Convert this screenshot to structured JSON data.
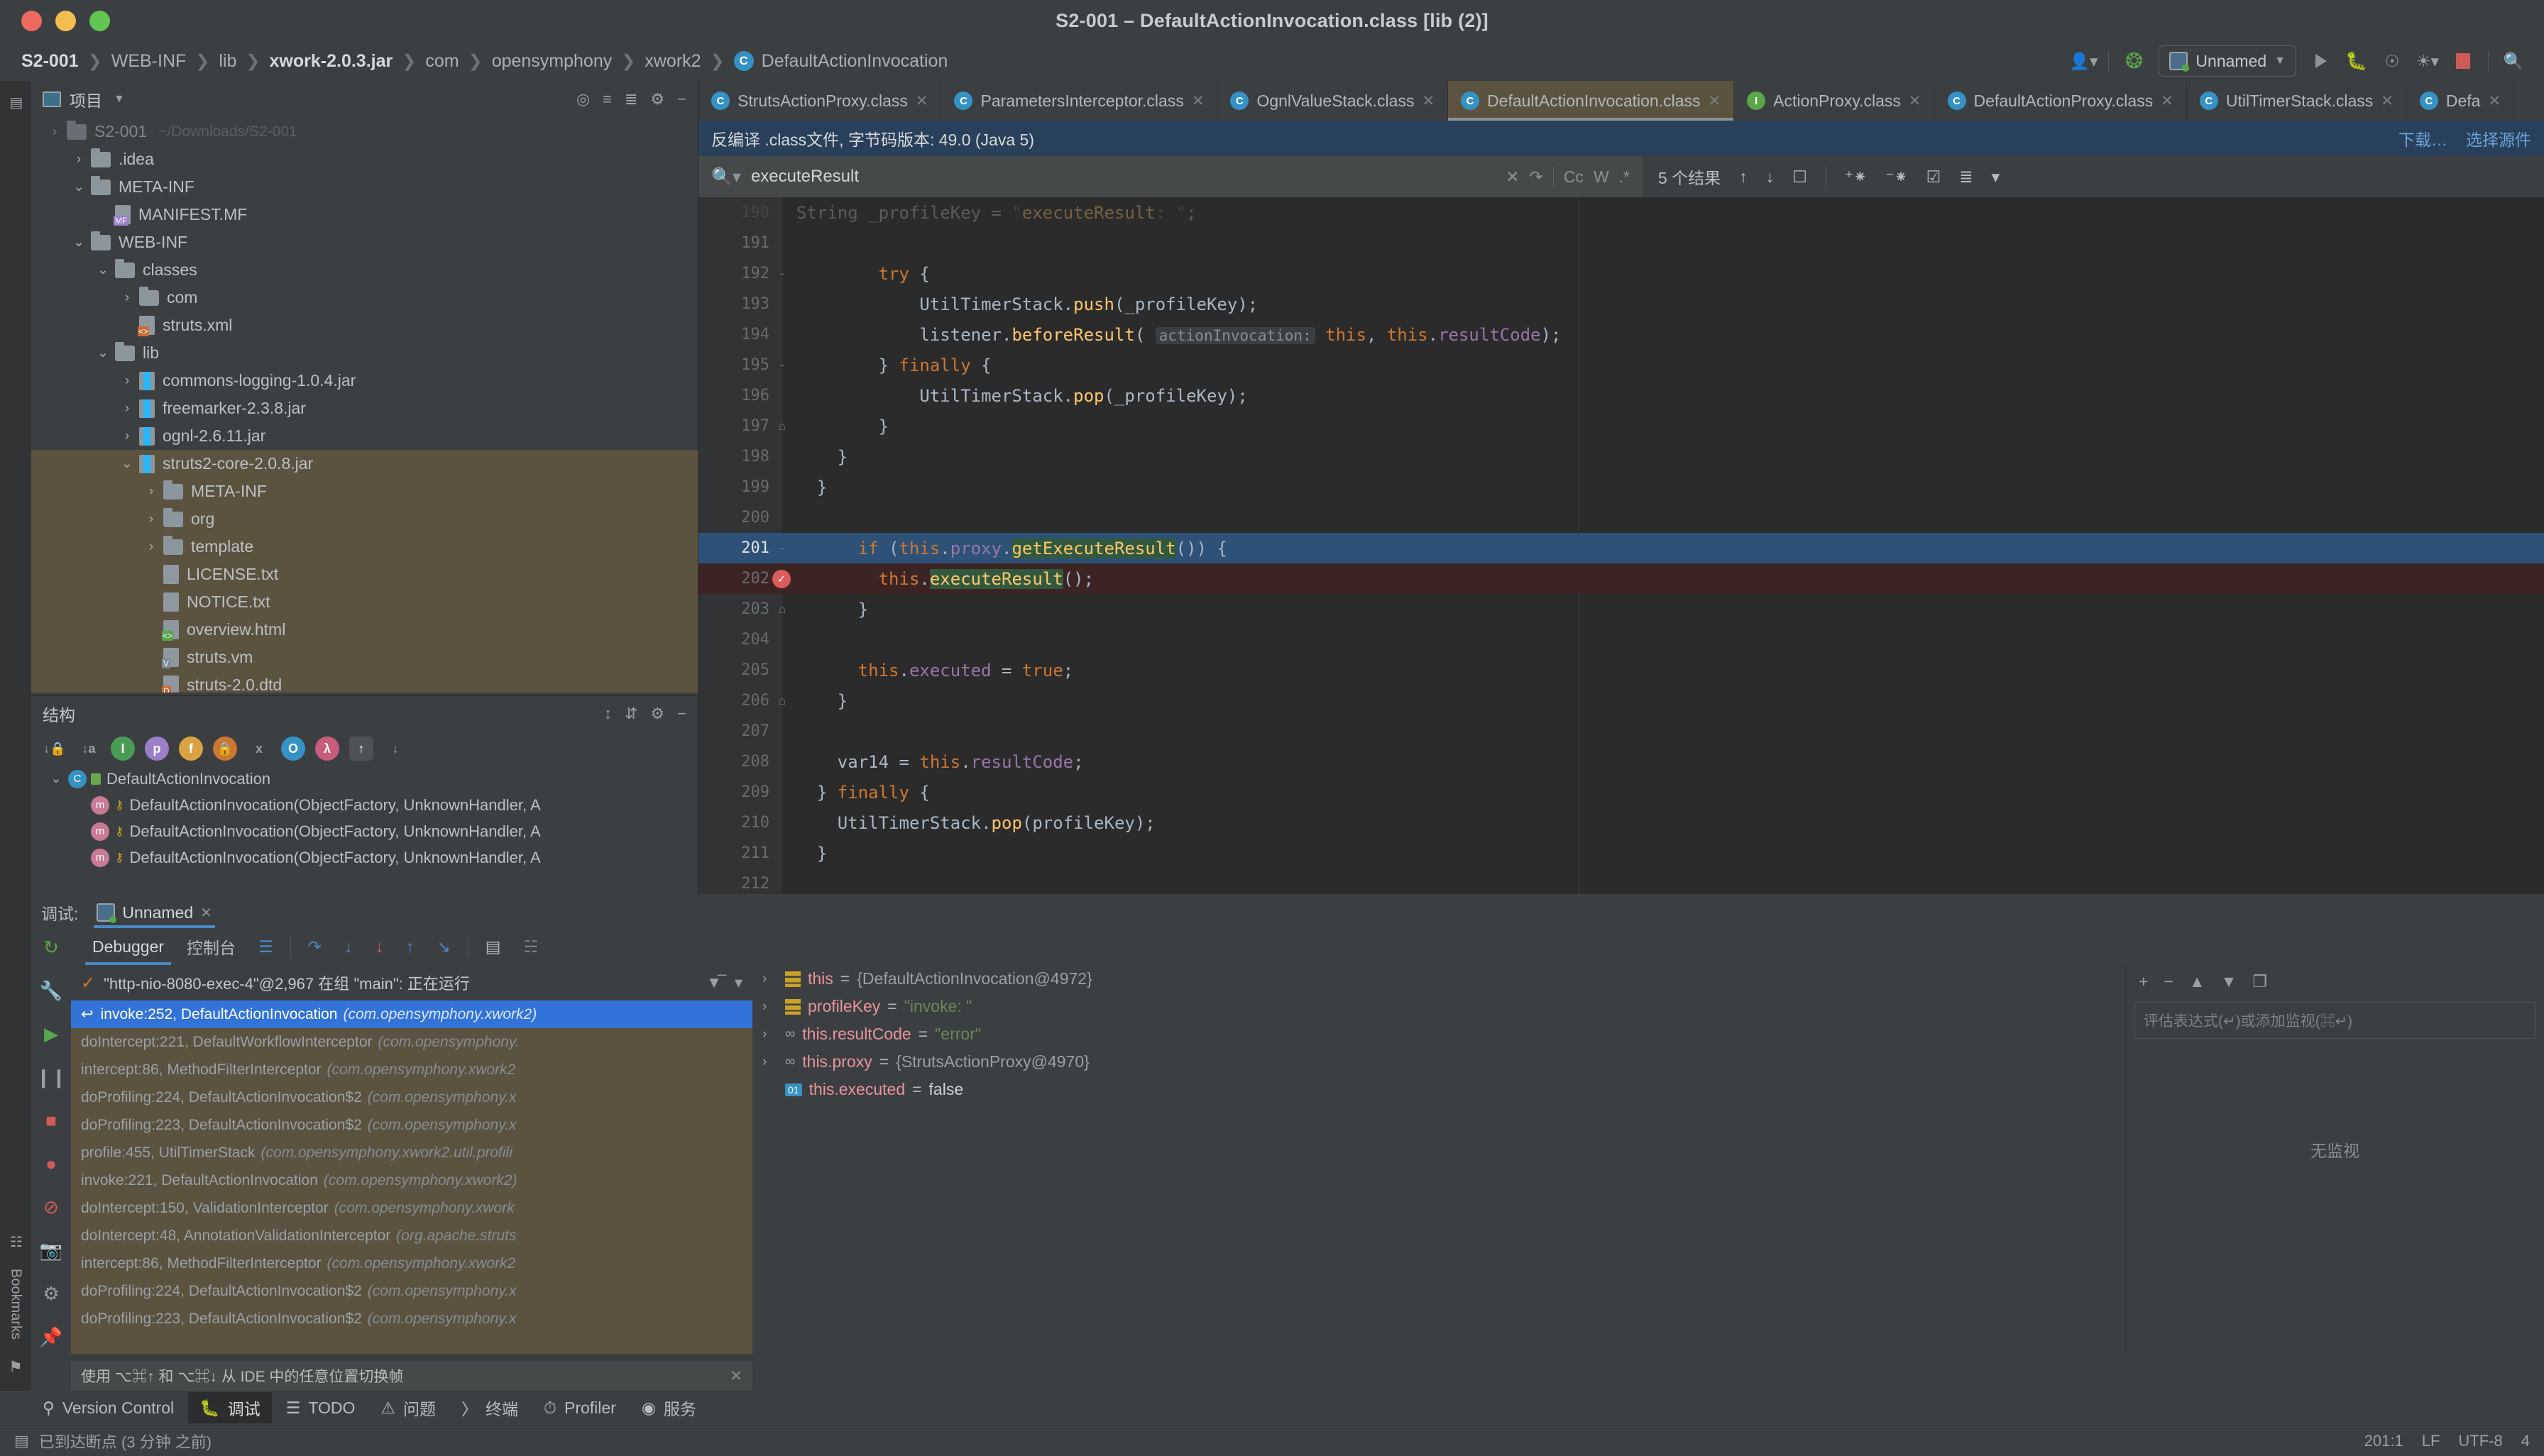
{
  "window": {
    "title": "S2-001 – DefaultActionInvocation.class [lib (2)]"
  },
  "breadcrumb": {
    "items": [
      {
        "label": "S2-001",
        "bold": true
      },
      {
        "label": "WEB-INF",
        "bold": false
      },
      {
        "label": "lib",
        "bold": false
      },
      {
        "label": "xwork-2.0.3.jar",
        "bold": true
      },
      {
        "label": "com",
        "bold": false
      },
      {
        "label": "opensymphony",
        "bold": false
      },
      {
        "label": "xwork2",
        "bold": false
      },
      {
        "label": "DefaultActionInvocation",
        "bold": false,
        "icon": "class-icon"
      }
    ],
    "separator": "❯"
  },
  "toolbar": {
    "account_icon": "account-icon",
    "build_icon": "hammer-icon",
    "run_config_label": "Unnamed",
    "run_icon": "run-icon",
    "debug_icon": "debug-icon",
    "coverage_icon": "coverage-icon",
    "profile_icon": "profile-icon",
    "stop_icon": "stop-icon",
    "search_icon": "search-icon"
  },
  "project_panel": {
    "title": "项目",
    "root": {
      "name": "S2-001",
      "path": "~/Downloads/S2-001"
    },
    "tree": [
      {
        "indent": 0,
        "arrow": "›",
        "kind": "root",
        "label": "S2-001",
        "path": "~/Downloads/S2-001",
        "partial": true
      },
      {
        "indent": 1,
        "arrow": "›",
        "kind": "folder",
        "label": ".idea"
      },
      {
        "indent": 1,
        "arrow": "⌄",
        "kind": "folder",
        "label": "META-INF"
      },
      {
        "indent": 2,
        "arrow": "",
        "kind": "file-mf",
        "label": "MANIFEST.MF"
      },
      {
        "indent": 1,
        "arrow": "⌄",
        "kind": "folder",
        "label": "WEB-INF"
      },
      {
        "indent": 2,
        "arrow": "⌄",
        "kind": "folder",
        "label": "classes"
      },
      {
        "indent": 3,
        "arrow": "›",
        "kind": "folder",
        "label": "com"
      },
      {
        "indent": 3,
        "arrow": "",
        "kind": "file-xml",
        "label": "struts.xml"
      },
      {
        "indent": 2,
        "arrow": "⌄",
        "kind": "folder",
        "label": "lib"
      },
      {
        "indent": 3,
        "arrow": "›",
        "kind": "jar",
        "label": "commons-logging-1.0.4.jar"
      },
      {
        "indent": 3,
        "arrow": "›",
        "kind": "jar",
        "label": "freemarker-2.3.8.jar"
      },
      {
        "indent": 3,
        "arrow": "›",
        "kind": "jar",
        "label": "ognl-2.6.11.jar"
      },
      {
        "indent": 3,
        "arrow": "⌄",
        "kind": "jar",
        "label": "struts2-core-2.0.8.jar",
        "selected": true
      },
      {
        "indent": 4,
        "arrow": "›",
        "kind": "folder",
        "label": "META-INF",
        "selected": true
      },
      {
        "indent": 4,
        "arrow": "›",
        "kind": "folder",
        "label": "org",
        "selected": true
      },
      {
        "indent": 4,
        "arrow": "›",
        "kind": "folder",
        "label": "template",
        "selected": true
      },
      {
        "indent": 4,
        "arrow": "",
        "kind": "file-txt",
        "label": "LICENSE.txt",
        "selected": true
      },
      {
        "indent": 4,
        "arrow": "",
        "kind": "file-txt",
        "label": "NOTICE.txt",
        "selected": true
      },
      {
        "indent": 4,
        "arrow": "",
        "kind": "file-html",
        "label": "overview.html",
        "selected": true
      },
      {
        "indent": 4,
        "arrow": "",
        "kind": "file-vm",
        "label": "struts.vm",
        "selected": true
      },
      {
        "indent": 4,
        "arrow": "",
        "kind": "file-dtd",
        "label": "struts-2.0.dtd",
        "selected": true
      }
    ]
  },
  "structure_panel": {
    "title": "结构",
    "toolbar_icons": [
      "sort-by-visibility-icon",
      "sort-alphabetically-icon",
      "show-inherited-icon",
      "show-properties-icon",
      "show-fields-icon",
      "show-non-public-icon",
      "group-icon",
      "show-anonymous-icon",
      "show-lambdas-icon",
      "expand-all-icon",
      "collapse-all-icon"
    ],
    "head_icons": [
      "expand-all-icon",
      "collapse-all-icon",
      "settings-icon",
      "hide-icon"
    ],
    "items": [
      {
        "indent": 0,
        "arrow": "⌄",
        "kind": "class",
        "label": "DefaultActionInvocation"
      },
      {
        "indent": 1,
        "arrow": "",
        "kind": "method",
        "label": "DefaultActionInvocation(ObjectFactory, UnknownHandler, A"
      },
      {
        "indent": 1,
        "arrow": "",
        "kind": "method",
        "label": "DefaultActionInvocation(ObjectFactory, UnknownHandler, A"
      },
      {
        "indent": 1,
        "arrow": "",
        "kind": "method",
        "label": "DefaultActionInvocation(ObjectFactory, UnknownHandler, A"
      }
    ]
  },
  "editor": {
    "tabs": [
      {
        "label": "StrutsActionProxy.class",
        "icon": "class-icon",
        "active": false
      },
      {
        "label": "ParametersInterceptor.class",
        "icon": "class-icon",
        "active": false
      },
      {
        "label": "OgnlValueStack.class",
        "icon": "class-icon",
        "active": false
      },
      {
        "label": "DefaultActionInvocation.class",
        "icon": "class-icon",
        "active": true
      },
      {
        "label": "ActionProxy.class",
        "icon": "interface-icon",
        "active": false
      },
      {
        "label": "DefaultActionProxy.class",
        "icon": "class-icon",
        "active": false
      },
      {
        "label": "UtilTimerStack.class",
        "icon": "class-icon",
        "active": false
      },
      {
        "label": "Defa",
        "icon": "class-icon",
        "active": false
      }
    ],
    "notification": {
      "text": "反编译 .class文件, 字节码版本: 49.0 (Java 5)",
      "action_download": "下载…",
      "action_choose": "选择源件"
    },
    "find": {
      "query": "executeResult",
      "placeholder": "",
      "result_count": "5 个结果",
      "opt_case": "Cc",
      "opt_words": "W",
      "opt_regex": ".*",
      "close_icon": "close-icon",
      "history_icon": "history-icon",
      "prev_icon": "arrow-up-icon",
      "next_icon": "arrow-down-icon",
      "select_all_icon": "select-all-icon",
      "filter_icon": "filter-icon"
    },
    "code_lines": [
      {
        "num": 190,
        "fold": "",
        "text": "String _profileKey = \"executeResult: \";",
        "clipped": true
      },
      {
        "num": 191,
        "fold": "",
        "text": ""
      },
      {
        "num": 192,
        "fold": "-",
        "text": "        try {"
      },
      {
        "num": 193,
        "fold": "",
        "text": "            UtilTimerStack.push(_profileKey);"
      },
      {
        "num": 194,
        "fold": "",
        "text": "            listener.beforeResult( actionInvocation: this, this.resultCode);"
      },
      {
        "num": 195,
        "fold": "-",
        "text": "        } finally {"
      },
      {
        "num": 196,
        "fold": "",
        "text": "            UtilTimerStack.pop(_profileKey);"
      },
      {
        "num": 197,
        "fold": "⌂",
        "text": "        }"
      },
      {
        "num": 198,
        "fold": "",
        "text": "    }"
      },
      {
        "num": 199,
        "fold": "",
        "text": "  }"
      },
      {
        "num": 200,
        "fold": "",
        "text": ""
      },
      {
        "num": 201,
        "fold": "-",
        "text": "      if (this.proxy.getExecuteResult()) {",
        "highlight": "blue"
      },
      {
        "num": 202,
        "fold": "",
        "text": "        this.executeResult();",
        "highlight": "red",
        "breakpoint": true
      },
      {
        "num": 203,
        "fold": "⌂",
        "text": "      }"
      },
      {
        "num": 204,
        "fold": "",
        "text": ""
      },
      {
        "num": 205,
        "fold": "",
        "text": "      this.executed = true;"
      },
      {
        "num": 206,
        "fold": "⌂",
        "text": "    }"
      },
      {
        "num": 207,
        "fold": "",
        "text": ""
      },
      {
        "num": 208,
        "fold": "",
        "text": "    var14 = this.resultCode;"
      },
      {
        "num": 209,
        "fold": "",
        "text": "  } finally {"
      },
      {
        "num": 210,
        "fold": "",
        "text": "    UtilTimerStack.pop(profileKey);"
      },
      {
        "num": 211,
        "fold": "",
        "text": "  }"
      },
      {
        "num": 212,
        "fold": "",
        "text": ""
      }
    ]
  },
  "debug": {
    "label": "调试:",
    "session_tab": "Unnamed",
    "tabs": [
      {
        "label": "Debugger",
        "active": true
      },
      {
        "label": "控制台",
        "active": false
      }
    ],
    "toolbar_icons": [
      "frames-icon",
      "step-over-icon",
      "step-into-icon",
      "force-step-into-icon",
      "step-out-icon",
      "run-to-cursor-icon",
      "evaluate-icon",
      "mute-breakpoints-icon"
    ],
    "rail_icons": [
      "rerun-icon",
      "settings-icon",
      "resume-icon",
      "pause-icon",
      "stop-icon",
      "breakpoints-icon",
      "mute-breakpoints-icon",
      "camera-icon",
      "settings2-icon",
      "pin-icon"
    ],
    "thread": {
      "status_icon": "check-icon",
      "label": "\"http-nio-8080-exec-4\"@2,967 在组 \"main\": 正在运行",
      "filter_icon": "filter-icon",
      "dropdown_icon": "chevron-down-icon"
    },
    "frames": [
      {
        "text": "invoke:252, DefaultActionInvocation",
        "pkg": "(com.opensymphony.xwork2)",
        "selected": true,
        "icon": "return-arrow-icon"
      },
      {
        "text": "doIntercept:221, DefaultWorkflowInterceptor",
        "pkg": "(com.opensymphony.",
        "selected": false
      },
      {
        "text": "intercept:86, MethodFilterInterceptor",
        "pkg": "(com.opensymphony.xwork2",
        "selected": false
      },
      {
        "text": "doProfiling:224, DefaultActionInvocation$2",
        "pkg": "(com.opensymphony.x",
        "selected": false
      },
      {
        "text": "doProfiling:223, DefaultActionInvocation$2",
        "pkg": "(com.opensymphony.x",
        "selected": false
      },
      {
        "text": "profile:455, UtilTimerStack",
        "pkg": "(com.opensymphony.xwork2.util.profili",
        "selected": false
      },
      {
        "text": "invoke:221, DefaultActionInvocation",
        "pkg": "(com.opensymphony.xwork2)",
        "selected": false
      },
      {
        "text": "doIntercept:150, ValidationInterceptor",
        "pkg": "(com.opensymphony.xwork",
        "selected": false
      },
      {
        "text": "doIntercept:48, AnnotationValidationInterceptor",
        "pkg": "(org.apache.struts",
        "selected": false
      },
      {
        "text": "intercept:86, MethodFilterInterceptor",
        "pkg": "(com.opensymphony.xwork2",
        "selected": false
      },
      {
        "text": "doProfiling:224, DefaultActionInvocation$2",
        "pkg": "(com.opensymphony.x",
        "selected": false
      },
      {
        "text": "doProfiling:223, DefaultActionInvocation$2",
        "pkg": "(com.opensymphony.x",
        "selected": false
      }
    ],
    "frames_hint": "使用 ⌥⌘↑ 和 ⌥⌘↓ 从 IDE 中的任意位置切换帧",
    "variables": [
      {
        "arrow": "›",
        "icon": "field-icon",
        "name": "this",
        "eq": "=",
        "value": "{DefaultActionInvocation@4972}",
        "value_kind": "object"
      },
      {
        "arrow": "›",
        "icon": "field-icon",
        "name": "profileKey",
        "eq": "=",
        "value": "\"invoke: \"",
        "value_kind": "string"
      },
      {
        "arrow": "›",
        "icon": "watch-icon",
        "name": "this.resultCode",
        "eq": "=",
        "value": "\"error\"",
        "value_kind": "string"
      },
      {
        "arrow": "›",
        "icon": "watch-icon",
        "name": "this.proxy",
        "eq": "=",
        "value": "{StrutsActionProxy@4970}",
        "value_kind": "object"
      },
      {
        "arrow": "",
        "icon": "bool-icon",
        "name": "this.executed",
        "eq": "=",
        "value": "false",
        "value_kind": "bool"
      }
    ],
    "watches": {
      "toolbar_icons": [
        "add-icon",
        "remove-icon",
        "move-up-icon",
        "move-down-icon",
        "copy-icon"
      ],
      "placeholder": "评估表达式(↵)或添加监视(⌘↵)",
      "empty_text": "无监视"
    }
  },
  "toolwindow_bar": {
    "items": [
      {
        "label": "Version Control",
        "icon": "branch-icon",
        "active": false
      },
      {
        "label": "调试",
        "icon": "debug-icon",
        "active": true
      },
      {
        "label": "TODO",
        "icon": "list-icon",
        "active": false
      },
      {
        "label": "问题",
        "icon": "warning-icon",
        "active": false
      },
      {
        "label": "终端",
        "icon": "terminal-icon",
        "active": false
      },
      {
        "label": "Profiler",
        "icon": "profiler-icon",
        "active": false
      },
      {
        "label": "服务",
        "icon": "services-icon",
        "active": false
      }
    ]
  },
  "statusbar": {
    "message": "已到达断点 (3 分钟 之前)",
    "message_icon": "info-icon",
    "caret": "201:1",
    "line_sep": "LF",
    "encoding": "UTF-8",
    "indent": "4"
  },
  "left_rail": {
    "top_icon": "project-icon",
    "bottom_items": [
      "structure-icon",
      "bookmarks-icon",
      "notifications-icon"
    ]
  }
}
